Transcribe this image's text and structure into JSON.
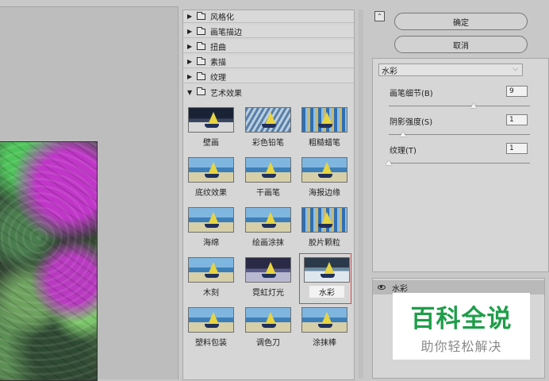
{
  "categories": [
    {
      "label": "风格化",
      "expanded": false
    },
    {
      "label": "画笔描边",
      "expanded": false
    },
    {
      "label": "扭曲",
      "expanded": false
    },
    {
      "label": "素描",
      "expanded": false
    },
    {
      "label": "纹理",
      "expanded": false
    },
    {
      "label": "艺术效果",
      "expanded": true
    }
  ],
  "filters": [
    {
      "label": "壁画"
    },
    {
      "label": "彩色铅笔"
    },
    {
      "label": "粗糙蜡笔"
    },
    {
      "label": "底纹效果"
    },
    {
      "label": "干画笔"
    },
    {
      "label": "海报边缘"
    },
    {
      "label": "海绵"
    },
    {
      "label": "绘画涂抹"
    },
    {
      "label": "胶片颗粒"
    },
    {
      "label": "木刻"
    },
    {
      "label": "霓虹灯光"
    },
    {
      "label": "水彩",
      "selected": true
    },
    {
      "label": "塑料包装"
    },
    {
      "label": "调色刀"
    },
    {
      "label": "涂抹棒"
    }
  ],
  "buttons": {
    "ok": "确定",
    "cancel": "取消"
  },
  "settings": {
    "selected_filter": "水彩",
    "params": [
      {
        "label": "画笔细节(B)",
        "value": "9",
        "fraction": 0.6
      },
      {
        "label": "阴影强度(S)",
        "value": "1",
        "fraction": 0.1
      },
      {
        "label": "纹理(T)",
        "value": "1",
        "fraction": 0.0
      }
    ]
  },
  "layers": [
    {
      "name": "水彩",
      "visible": true
    }
  ],
  "watermark": {
    "title": "百科全说",
    "subtitle": "助你轻松解决"
  },
  "icons": {
    "expand_arrow": "triangle-right",
    "collapsed_arrow": "triangle-down",
    "folder": "folder-icon",
    "visibility": "eye-icon",
    "collapse": "collapse-icon"
  },
  "colors": {
    "selection_outline": "#d14646",
    "watermark_green": "#1f9e4a"
  }
}
